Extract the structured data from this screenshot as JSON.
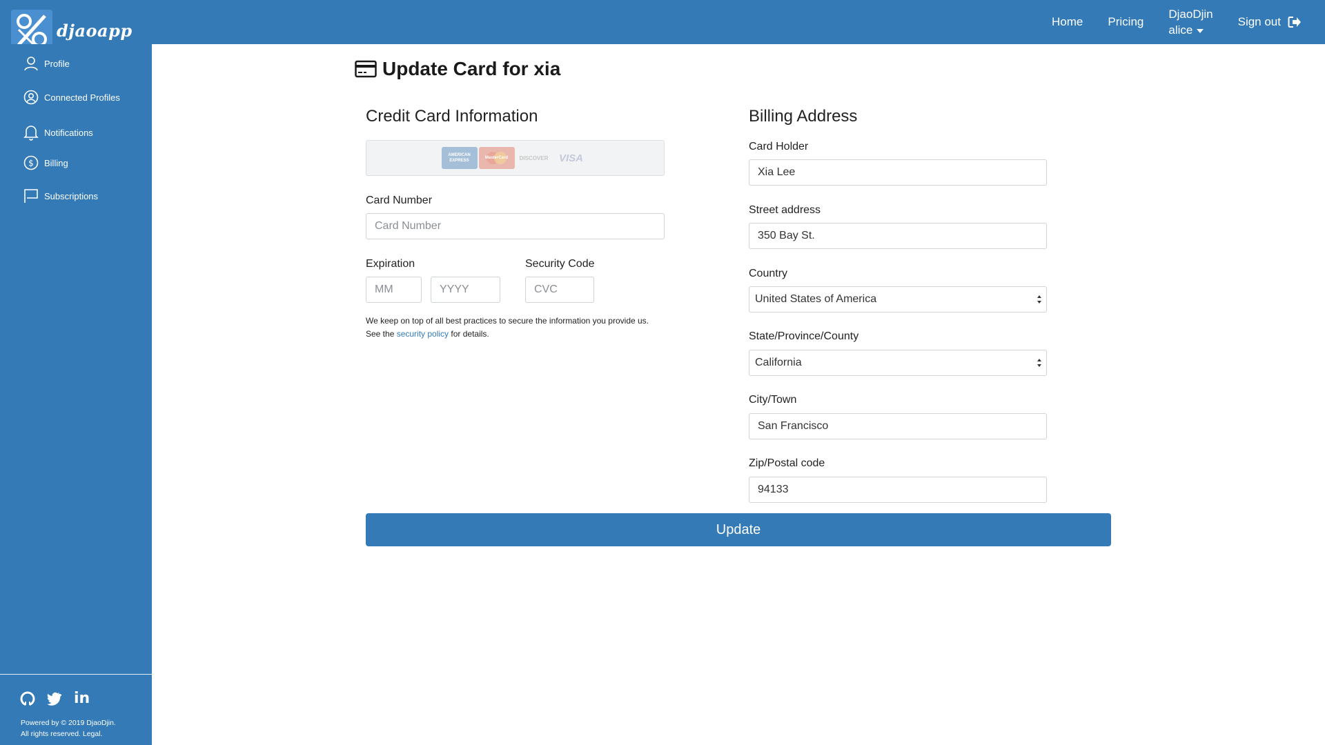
{
  "app": {
    "brand": "djaoapp"
  },
  "nav": {
    "home": "Home",
    "pricing": "Pricing",
    "org": "DjaoDjin",
    "user": "alice",
    "signout": "Sign out"
  },
  "sidebar": {
    "items": [
      {
        "label": "Profile",
        "icon": "user-icon"
      },
      {
        "label": "Connected Profiles",
        "icon": "user-circle-icon"
      },
      {
        "label": "Notifications",
        "icon": "bell-icon"
      },
      {
        "label": "Billing",
        "icon": "dollar-circle-icon"
      },
      {
        "label": "Subscriptions",
        "icon": "flag-icon"
      }
    ],
    "footer": {
      "line1": "Powered by © 2019 DjaoDjin.",
      "line2": "All rights reserved. Legal."
    }
  },
  "page": {
    "title": "Update Card for xia"
  },
  "card": {
    "section_title": "Credit Card Information",
    "brands": [
      "AMERICAN EXPRESS",
      "MasterCard",
      "DISCOVER",
      "VISA"
    ],
    "number_label": "Card Number",
    "number_placeholder": "Card Number",
    "expiration_label": "Expiration",
    "month_placeholder": "MM",
    "year_placeholder": "YYYY",
    "security_label": "Security Code",
    "cvc_placeholder": "CVC",
    "note_before": "We keep on top of all best practices to secure the information you provide us. See the ",
    "note_link": "security policy",
    "note_after": " for details."
  },
  "billing": {
    "section_title": "Billing Address",
    "holder_label": "Card Holder",
    "holder_value": "Xia Lee",
    "street_label": "Street address",
    "street_value": "350 Bay St.",
    "country_label": "Country",
    "country_value": "United States of America",
    "state_label": "State/Province/County",
    "state_value": "California",
    "city_label": "City/Town",
    "city_value": "San Francisco",
    "zip_label": "Zip/Postal code",
    "zip_value": "94133"
  },
  "actions": {
    "update": "Update"
  },
  "colors": {
    "brand_blue": "#337ab7"
  }
}
